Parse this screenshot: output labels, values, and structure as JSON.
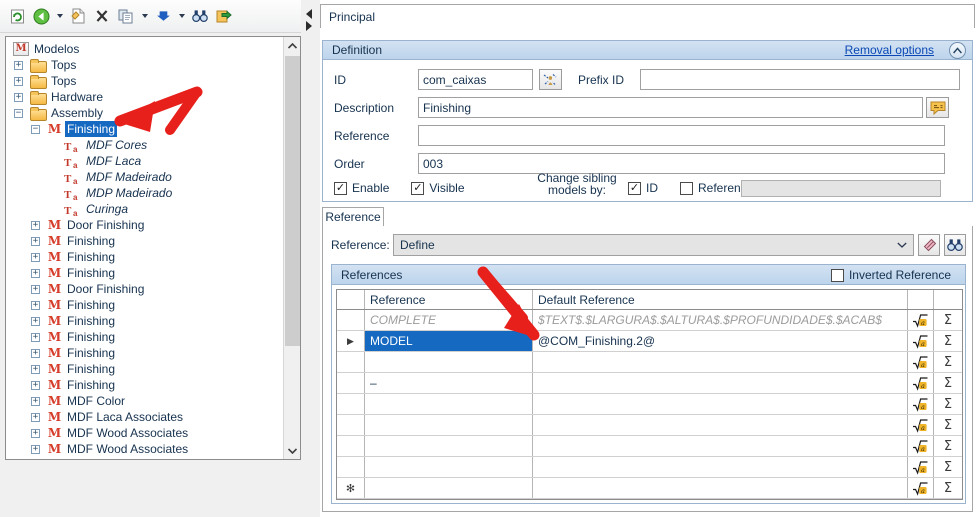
{
  "toolbar": {
    "buttons": [
      {
        "name": "refresh-icon",
        "glyph": "↻"
      },
      {
        "name": "back-arrow-icon",
        "glyph": "◀"
      },
      {
        "name": "back-dropdown-caret",
        "glyph": "▾"
      },
      {
        "name": "new-document-icon",
        "glyph": "❐"
      },
      {
        "name": "delete-icon",
        "glyph": "✕"
      },
      {
        "name": "copy-icon",
        "glyph": "⧉"
      },
      {
        "name": "copy-dropdown-caret",
        "glyph": "▾"
      },
      {
        "name": "move-down-icon",
        "glyph": "⬇"
      },
      {
        "name": "move-down-dropdown-caret",
        "glyph": "▾"
      },
      {
        "name": "find-icon",
        "glyph": "ԱԱ"
      },
      {
        "name": "export-icon",
        "glyph": "↪"
      }
    ]
  },
  "tree": {
    "root_label": "Modelos",
    "items": [
      {
        "label": "Tops",
        "type": "folder",
        "state": "collapsed",
        "depth": 1
      },
      {
        "label": "Tops",
        "type": "folder",
        "state": "collapsed",
        "depth": 1
      },
      {
        "label": "Hardware",
        "type": "folder",
        "state": "collapsed",
        "depth": 1
      },
      {
        "label": "Assembly",
        "type": "folder",
        "state": "expanded",
        "depth": 1
      },
      {
        "label": "Finishing",
        "type": "model",
        "state": "expanded",
        "depth": 2,
        "selected": true
      },
      {
        "label": "MDF Cores",
        "type": "text",
        "state": "leaf",
        "depth": 3
      },
      {
        "label": "MDF Laca",
        "type": "text",
        "state": "leaf",
        "depth": 3
      },
      {
        "label": "MDF Madeirado",
        "type": "text",
        "state": "leaf",
        "depth": 3
      },
      {
        "label": "MDP Madeirado",
        "type": "text",
        "state": "leaf",
        "depth": 3
      },
      {
        "label": "Curinga",
        "type": "text",
        "state": "leaf",
        "depth": 3
      },
      {
        "label": "Door Finishing",
        "type": "model",
        "state": "collapsed",
        "depth": 2
      },
      {
        "label": "Finishing",
        "type": "model",
        "state": "collapsed",
        "depth": 2
      },
      {
        "label": "Finishing",
        "type": "model",
        "state": "collapsed",
        "depth": 2
      },
      {
        "label": "Finishing",
        "type": "model",
        "state": "collapsed",
        "depth": 2
      },
      {
        "label": "Door Finishing",
        "type": "model",
        "state": "collapsed",
        "depth": 2
      },
      {
        "label": "Finishing",
        "type": "model",
        "state": "collapsed",
        "depth": 2
      },
      {
        "label": "Finishing",
        "type": "model",
        "state": "collapsed",
        "depth": 2
      },
      {
        "label": "Finishing",
        "type": "model",
        "state": "collapsed",
        "depth": 2
      },
      {
        "label": "Finishing",
        "type": "model",
        "state": "collapsed",
        "depth": 2
      },
      {
        "label": "Finishing",
        "type": "model",
        "state": "collapsed",
        "depth": 2
      },
      {
        "label": "Finishing",
        "type": "model",
        "state": "collapsed",
        "depth": 2
      },
      {
        "label": "MDF Color",
        "type": "model",
        "state": "collapsed",
        "depth": 2
      },
      {
        "label": "MDF Laca Associates",
        "type": "model",
        "state": "collapsed",
        "depth": 2
      },
      {
        "label": "MDF Wood Associates",
        "type": "model",
        "state": "collapsed",
        "depth": 2
      },
      {
        "label": "MDF Wood Associates",
        "type": "model",
        "state": "collapsed",
        "depth": 2
      }
    ]
  },
  "tab": {
    "principal_label": "Principal"
  },
  "definition": {
    "header_title": "Definition",
    "removal_options_label": "Removal options",
    "collapse_glyph": "⌃",
    "id_label": "ID",
    "id_value": "com_caixas",
    "prefix_id_label": "Prefix ID",
    "prefix_id_value": "",
    "description_label": "Description",
    "description_value": "Finishing",
    "reference_label": "Reference",
    "reference_value": "",
    "order_label": "Order",
    "order_value": "003",
    "enable_label": "Enable",
    "enable_checked": "✓",
    "visible_label": "Visible",
    "visible_checked": "✓",
    "change_sibling_line1": "Change sibling",
    "change_sibling_line2": "models by:",
    "sibling_id_label": "ID",
    "sibling_id_checked": "✓",
    "sibling_reference_label": "Reference",
    "sibling_reference_checked": ""
  },
  "reference_tab": {
    "tab_label": "Reference",
    "combo_label": "Reference:",
    "combo_value": "Define",
    "combo_caret": "⌵",
    "eraser_glyph": "✎",
    "find_glyph": "ԱԱ"
  },
  "references": {
    "panel_title": "References",
    "inverted_label": "Inverted Reference",
    "inverted_checked": "",
    "columns": [
      "",
      "Reference",
      "Default Reference",
      "",
      ""
    ],
    "rows": [
      {
        "marker": "",
        "reference": "COMPLETE",
        "default_reference": "$TEXT$.$LARGURA$.$ALTURA$.$PROFUNDIDADE$.$ACAB$",
        "style": "ghost"
      },
      {
        "marker": "▶",
        "reference": "MODEL",
        "default_reference": "@COM_Finishing.2@",
        "style": "selected"
      },
      {
        "marker": "",
        "reference": "",
        "default_reference": "",
        "style": "empty"
      },
      {
        "marker": "",
        "reference": "–",
        "default_reference": "",
        "style": "empty"
      },
      {
        "marker": "",
        "reference": "",
        "default_reference": "",
        "style": "empty"
      },
      {
        "marker": "",
        "reference": "",
        "default_reference": "",
        "style": "empty"
      },
      {
        "marker": "",
        "reference": "",
        "default_reference": "",
        "style": "empty"
      },
      {
        "marker": "",
        "reference": "",
        "default_reference": "",
        "style": "empty"
      },
      {
        "marker": "✻",
        "reference": "",
        "default_reference": "",
        "style": "newrow"
      }
    ],
    "sqrt_icon_name": "formula-icon",
    "sum_glyph": "Σ"
  },
  "colors": {
    "selection_blue": "#1669c1",
    "panel_header_blue": "#bcd4ec",
    "link_blue": "#0b48b5",
    "annotation_red": "#e8201b",
    "model_icon_red": "#d53d2a"
  }
}
